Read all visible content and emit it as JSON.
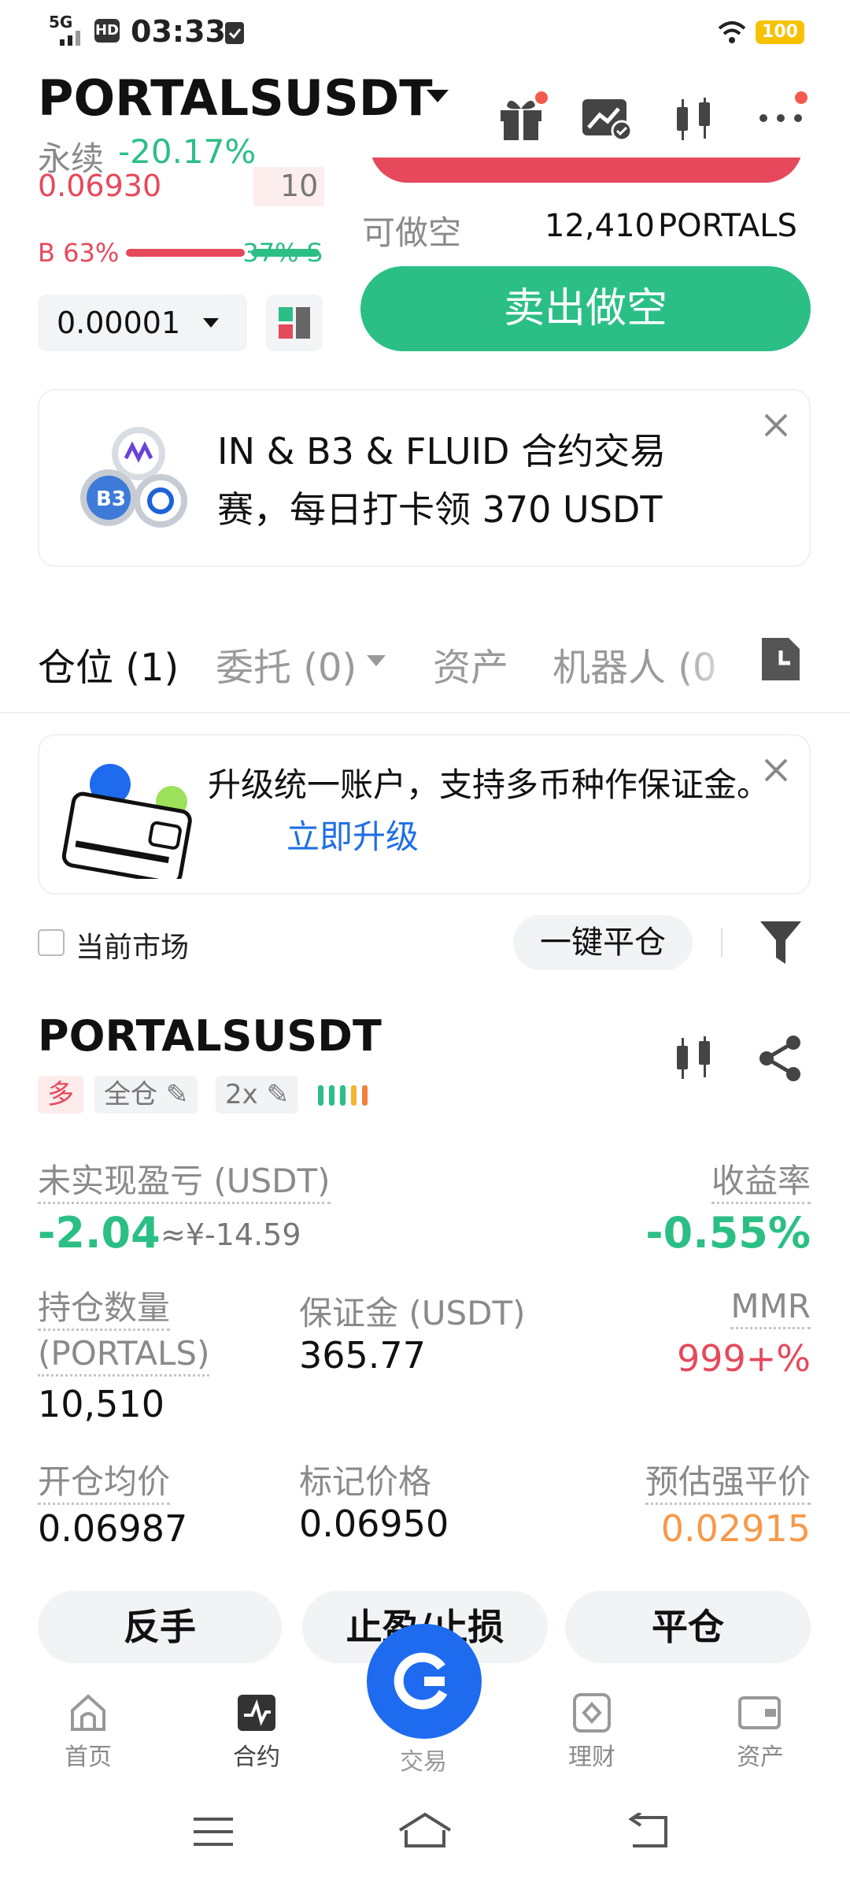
{
  "status": {
    "time": "03:33",
    "network": "5G",
    "hd": "HD",
    "battery": "100"
  },
  "header": {
    "symbol": "PORTALSUSDT",
    "type_label": "永续",
    "change": "-20.17%"
  },
  "orderbook": {
    "price": "0.06930",
    "qty": "10",
    "buy_pct": "B 63%",
    "sell_pct": "37% S",
    "buy_ratio": 0.63,
    "precision": "0.00001"
  },
  "order": {
    "available_label": "可做空",
    "available_value": "12,410",
    "available_unit": "PORTALS",
    "sell_button": "卖出做空"
  },
  "banner": {
    "text": "IN & B3 & FLUID 合约交易赛，每日打卡领 370 USDT"
  },
  "tabs": [
    {
      "label": "仓位 (1)"
    },
    {
      "label": "委托 (0)"
    },
    {
      "label": "资产"
    },
    {
      "label": "机器人 (0"
    }
  ],
  "upgrade": {
    "text": "升级统一账户，支持多币种作保证金。",
    "link": "立即升级"
  },
  "filter": {
    "current_market": "当前市场",
    "close_all": "一键平仓"
  },
  "position": {
    "symbol": "PORTALSUSDT",
    "side": "多",
    "margin_mode": "全仓",
    "leverage": "2x",
    "pnl_label": "未实现盈亏 (USDT)",
    "pnl_value": "-2.04",
    "pnl_cny": "≈¥-14.59",
    "roe_label": "收益率",
    "roe_value": "-0.55%",
    "qty_label_1": "持仓数量",
    "qty_label_2": "(PORTALS)",
    "qty_value": "10,510",
    "margin_label": "保证金 (USDT)",
    "margin_value": "365.77",
    "mmr_label": "MMR",
    "mmr_value": "999+%",
    "entry_label": "开仓均价",
    "entry_value": "0.06987",
    "mark_label": "标记价格",
    "mark_value": "0.06950",
    "liq_label": "预估强平价",
    "liq_value": "0.02915"
  },
  "actions": {
    "reverse": "反手",
    "tpsl": "止盈/止损",
    "close": "平仓"
  },
  "nav": {
    "home": "首页",
    "futures": "合约",
    "trade": "交易",
    "earn": "理财",
    "assets": "资产"
  },
  "colors": {
    "green": "#2bbf86",
    "red": "#e5495b",
    "orange": "#f59a4a",
    "link": "#1f6fe5"
  }
}
